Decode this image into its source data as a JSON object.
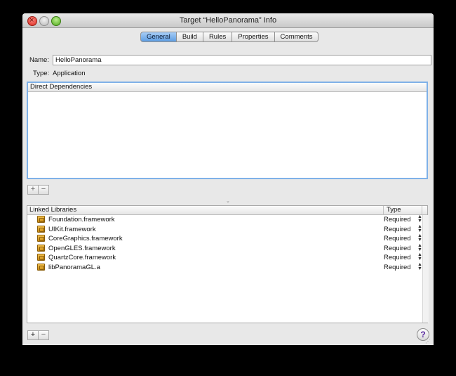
{
  "window": {
    "title": "Target “HelloPanorama” Info"
  },
  "tabs": [
    {
      "label": "General",
      "active": true
    },
    {
      "label": "Build"
    },
    {
      "label": "Rules"
    },
    {
      "label": "Properties"
    },
    {
      "label": "Comments"
    }
  ],
  "general": {
    "name_label": "Name:",
    "name_value": "HelloPanorama",
    "type_label": "Type:",
    "type_value": "Application"
  },
  "dependencies": {
    "header": "Direct Dependencies"
  },
  "controls": {
    "add": "+",
    "remove": "−"
  },
  "libraries": {
    "col_name": "Linked Libraries",
    "col_type": "Type",
    "rows": [
      {
        "name": "Foundation.framework",
        "type": "Required"
      },
      {
        "name": "UIKit.framework",
        "type": "Required"
      },
      {
        "name": "CoreGraphics.framework",
        "type": "Required"
      },
      {
        "name": "OpenGLES.framework",
        "type": "Required"
      },
      {
        "name": "QuartzCore.framework",
        "type": "Required"
      },
      {
        "name": "libPanoramaGL.a",
        "type": "Required"
      }
    ]
  },
  "help": "?",
  "icons": {
    "close": "close-icon",
    "minimize": "minimize-icon",
    "zoom": "zoom-icon",
    "library": "library-icon",
    "stepper": "stepper-icon",
    "help": "help-icon"
  }
}
